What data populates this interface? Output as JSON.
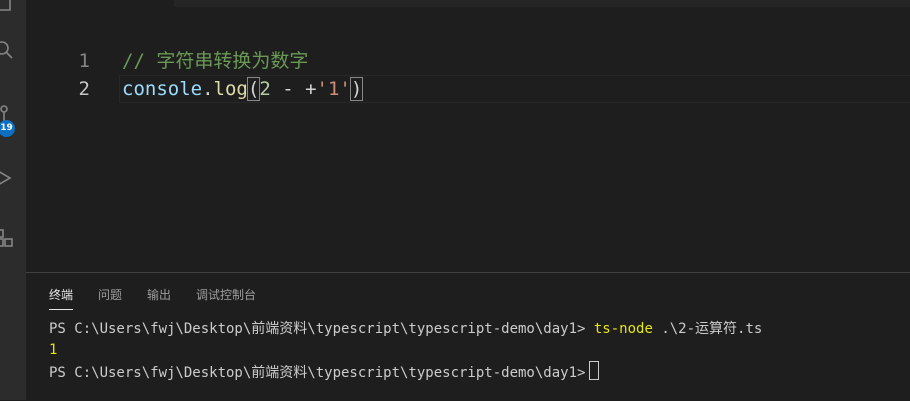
{
  "activity_bar": {
    "badge_count": "19",
    "icons": [
      "explorer-icon",
      "search-icon",
      "source-control-icon",
      "run-debug-icon",
      "extensions-icon"
    ]
  },
  "editor": {
    "lines": [
      {
        "number": "1",
        "comment": "// 字符串转换为数字"
      },
      {
        "number": "2",
        "tokens": {
          "object": "console",
          "dot": ".",
          "method": "log",
          "open_paren": "(",
          "num": "2",
          "op": " - +",
          "str": "'1'",
          "close_paren": ")"
        }
      }
    ]
  },
  "panel": {
    "tabs": [
      "终端",
      "问题",
      "输出",
      "调试控制台"
    ],
    "active_tab": "终端",
    "terminal": {
      "line1_prompt": "PS C:\\Users\\fwj\\Desktop\\前端资料\\typescript\\typescript-demo\\day1> ",
      "line1_cmd": "ts-node",
      "line1_args": " .\\2-运算符.ts",
      "line2_output": "1",
      "line3_prompt": "PS C:\\Users\\fwj\\Desktop\\前端资料\\typescript\\typescript-demo\\day1>"
    }
  },
  "colors": {
    "comment": "#6a9955",
    "variable": "#9cdcfe",
    "function": "#dcdcaa",
    "number": "#b5cea8",
    "string": "#ce9178",
    "terminal_command": "#e5e510"
  }
}
